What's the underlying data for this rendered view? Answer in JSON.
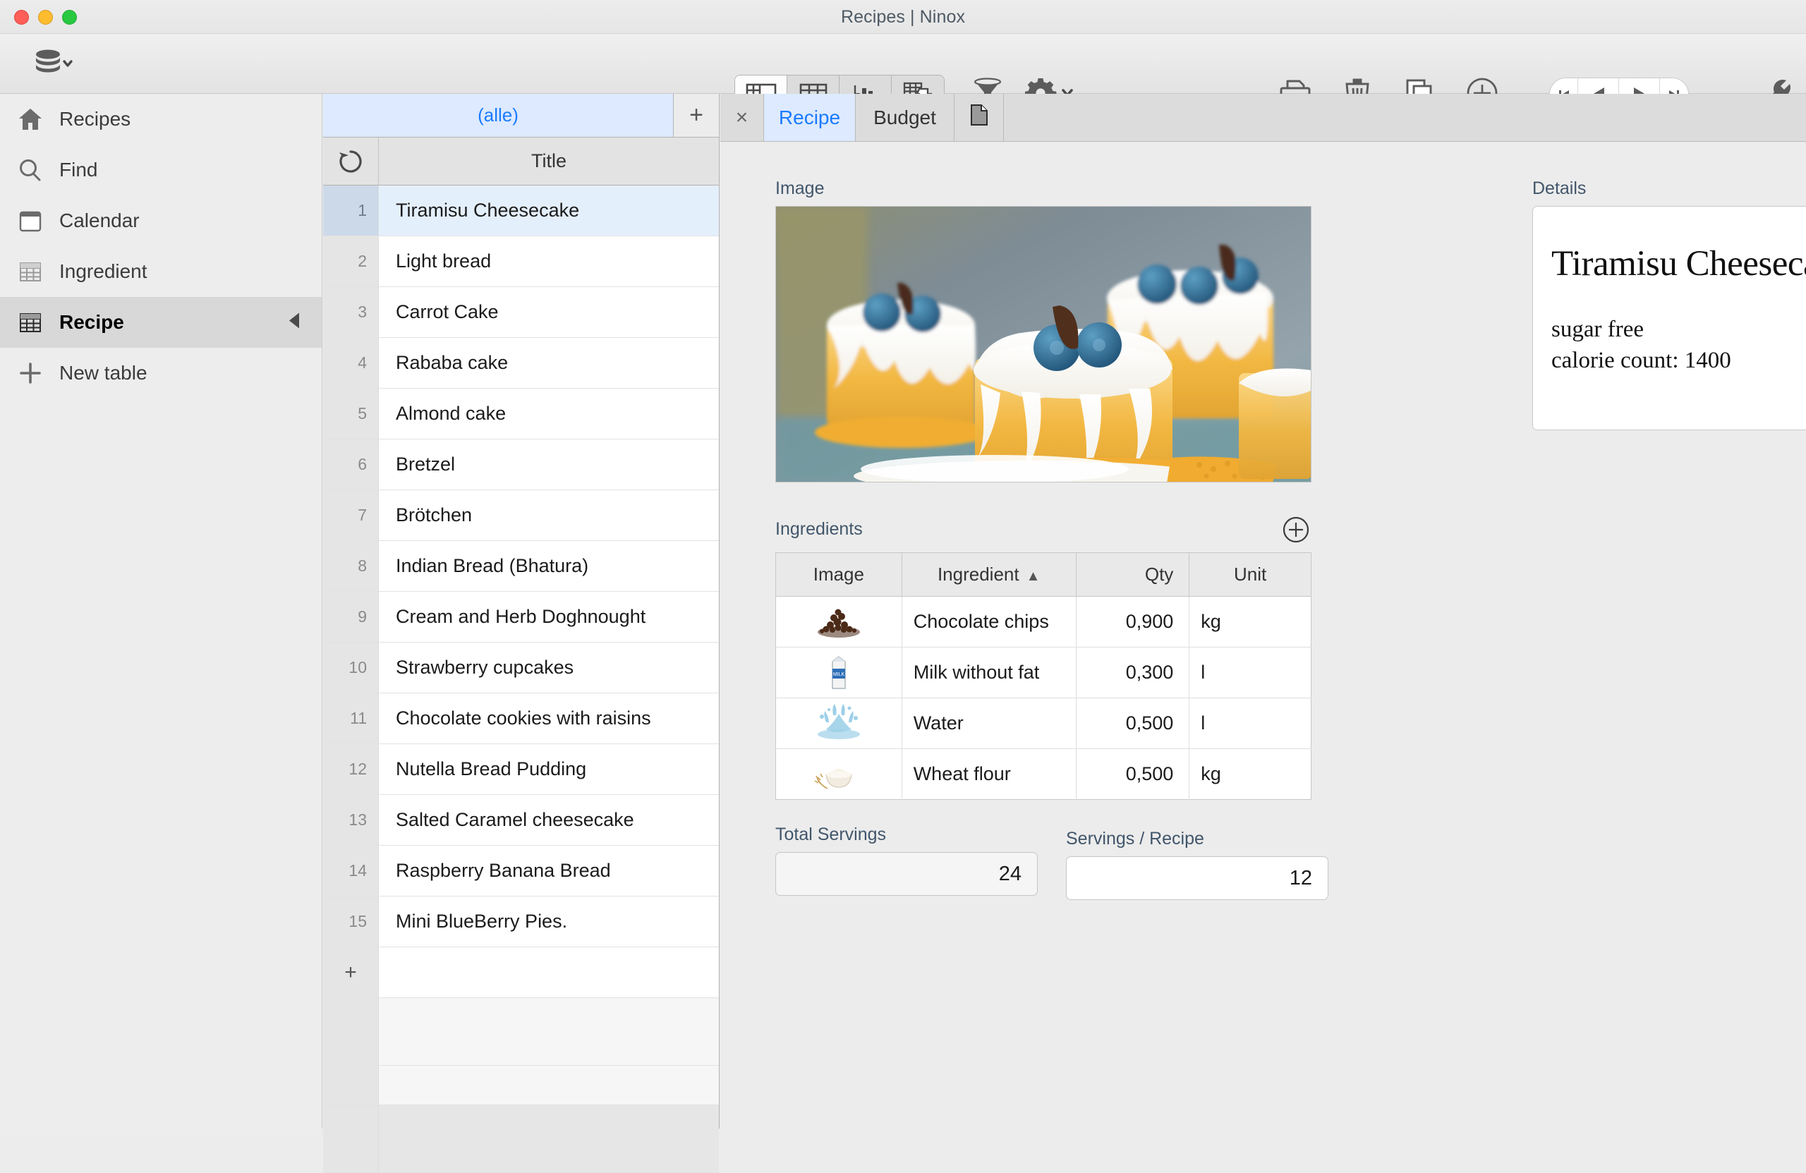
{
  "window": {
    "title": "Recipes | Ninox",
    "traffic_lights": [
      "close",
      "minimize",
      "zoom"
    ]
  },
  "toolbar": {
    "database_icon": "database-stack-icon",
    "view_modes": [
      {
        "name": "split-view",
        "icon": "split-table-icon",
        "active": true
      },
      {
        "name": "table-view",
        "icon": "grid-table-icon",
        "active": false
      },
      {
        "name": "chart-view",
        "icon": "bar-chart-icon",
        "active": false
      },
      {
        "name": "print-layout-view",
        "icon": "table-print-icon",
        "active": false
      }
    ],
    "filter_icon": "funnel-icon",
    "settings_icon": "gear-icon",
    "print_icon": "printer-icon",
    "delete_icon": "trash-icon",
    "duplicate_icon": "copy-icon",
    "add_icon": "plus-circle-icon",
    "nav": [
      {
        "name": "first-record",
        "icon": "skip-back-icon"
      },
      {
        "name": "previous-record",
        "icon": "play-back-icon"
      },
      {
        "name": "next-record",
        "icon": "play-forward-icon"
      },
      {
        "name": "last-record",
        "icon": "skip-forward-icon"
      }
    ],
    "tools_icon": "wrench-icon"
  },
  "sidebar": {
    "items": [
      {
        "label": "Recipes",
        "icon": "home-icon",
        "selected": false
      },
      {
        "label": "Find",
        "icon": "search-icon",
        "selected": false
      },
      {
        "label": "Calendar",
        "icon": "calendar-icon",
        "selected": false
      },
      {
        "label": "Ingredient",
        "icon": "table-icon",
        "selected": false
      },
      {
        "label": "Recipe",
        "icon": "table-icon",
        "selected": true
      },
      {
        "label": "New table",
        "icon": "plus-icon",
        "selected": false
      }
    ]
  },
  "list_panel": {
    "view_tab": "(alle)",
    "add_view_label": "+",
    "refresh_icon": "refresh-icon",
    "column_header": "Title",
    "add_row_label": "+",
    "rows": [
      {
        "num": "1",
        "title": "Tiramisu Cheesecake",
        "selected": true
      },
      {
        "num": "2",
        "title": "Light bread",
        "selected": false
      },
      {
        "num": "3",
        "title": "Carrot Cake",
        "selected": false
      },
      {
        "num": "4",
        "title": "Rababa cake",
        "selected": false
      },
      {
        "num": "5",
        "title": "Almond cake",
        "selected": false
      },
      {
        "num": "6",
        "title": "Bretzel",
        "selected": false
      },
      {
        "num": "7",
        "title": "Brötchen",
        "selected": false
      },
      {
        "num": "8",
        "title": "Indian Bread (Bhatura)",
        "selected": false
      },
      {
        "num": "9",
        "title": "Cream and Herb Doghnought",
        "selected": false
      },
      {
        "num": "10",
        "title": "Strawberry cupcakes",
        "selected": false
      },
      {
        "num": "11",
        "title": "Chocolate cookies with raisins",
        "selected": false
      },
      {
        "num": "12",
        "title": "Nutella Bread Pudding",
        "selected": false
      },
      {
        "num": "13",
        "title": "Salted Caramel cheesecake",
        "selected": false
      },
      {
        "num": "14",
        "title": "Raspberry Banana Bread",
        "selected": false
      },
      {
        "num": "15",
        "title": "Mini BlueBerry Pies.",
        "selected": false
      }
    ]
  },
  "record": {
    "tabs": [
      {
        "label": "×",
        "name": "close-record",
        "active": false
      },
      {
        "label": "Recipe",
        "name": "tab-recipe",
        "active": true
      },
      {
        "label": "Budget",
        "name": "tab-budget",
        "active": false
      },
      {
        "label": "",
        "name": "tab-document",
        "active": false,
        "icon": "document-icon"
      }
    ],
    "image_label": "Image",
    "image_alt": "Blueberry topped mini cheesecakes on a white cake stand",
    "details_label": "Details",
    "details_title": "Tiramisu Cheesecake",
    "details_line1": "sugar free",
    "details_line2": "calorie count: 1400",
    "ingredients_label": "Ingredients",
    "ingredients_add_icon": "plus-circle-icon",
    "ingredients_columns": [
      "Image",
      "Ingredient",
      "Qty",
      "Unit"
    ],
    "ingredients_sort_column": "Ingredient",
    "ingredients_sort_direction": "asc",
    "ingredients": [
      {
        "image": "chocolate-chips-thumb",
        "name": "Chocolate chips",
        "qty": "0,900",
        "unit": "kg"
      },
      {
        "image": "milk-carton-thumb",
        "name": "Milk without fat",
        "qty": "0,300",
        "unit": "l"
      },
      {
        "image": "water-splash-thumb",
        "name": "Water",
        "qty": "0,500",
        "unit": "l"
      },
      {
        "image": "flour-bowl-thumb",
        "name": "Wheat flour",
        "qty": "0,500",
        "unit": "kg"
      }
    ],
    "total_servings_label": "Total Servings",
    "total_servings_value": "24",
    "servings_per_recipe_label": "Servings / Recipe",
    "servings_per_recipe_value": "12"
  },
  "colors": {
    "accent_blue": "#1a7bff",
    "selection_blue": "#ddeaff",
    "row_selection": "#e4effc",
    "label_slate": "#41566b",
    "chrome_gray": "#ececec"
  }
}
